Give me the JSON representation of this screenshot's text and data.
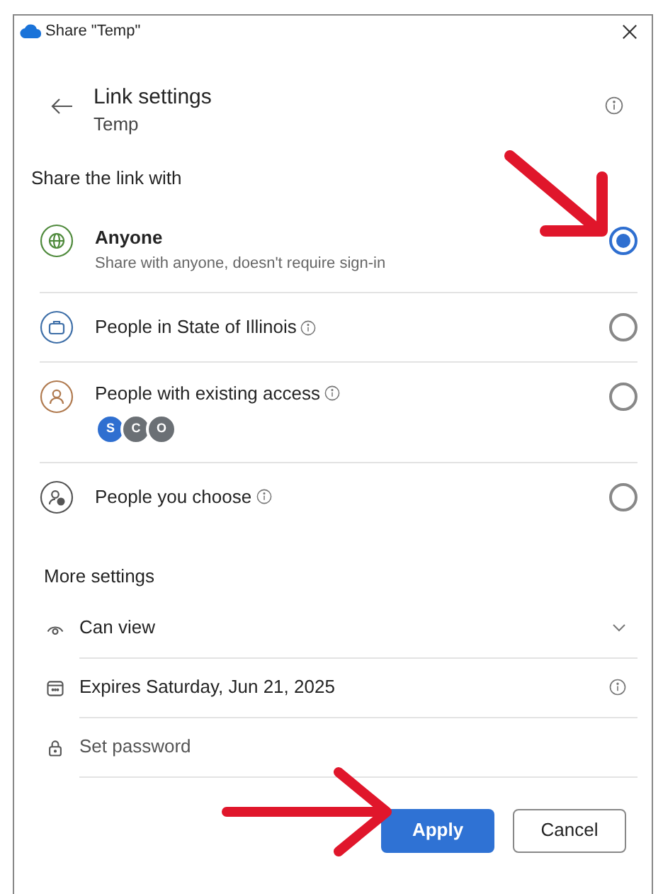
{
  "window": {
    "title": "Share \"Temp\""
  },
  "header": {
    "title": "Link settings",
    "subtitle": "Temp"
  },
  "share_section": {
    "title": "Share the link with",
    "options": [
      {
        "label": "Anyone",
        "description": "Share with anyone, doesn't require sign-in",
        "info": false,
        "selected": true
      },
      {
        "label": "People in State of Illinois",
        "info": true,
        "selected": false
      },
      {
        "label": "People with existing access",
        "info": true,
        "selected": false,
        "avatars": [
          {
            "initials": "S",
            "color": "#2f6fd0"
          },
          {
            "initials": "C",
            "color": "#6b7075"
          },
          {
            "initials": "O",
            "color": "#6b7075"
          }
        ]
      },
      {
        "label": "People you choose",
        "info": true,
        "selected": false
      }
    ]
  },
  "more_settings": {
    "title": "More settings",
    "rows": [
      {
        "kind": "dropdown",
        "value": "Can view"
      },
      {
        "kind": "info",
        "value": "Expires Saturday, Jun 21, 2025"
      },
      {
        "kind": "input",
        "placeholder": "Set password"
      }
    ]
  },
  "buttons": [
    {
      "label": "Apply",
      "primary": true
    },
    {
      "label": "Cancel",
      "primary": false
    }
  ]
}
